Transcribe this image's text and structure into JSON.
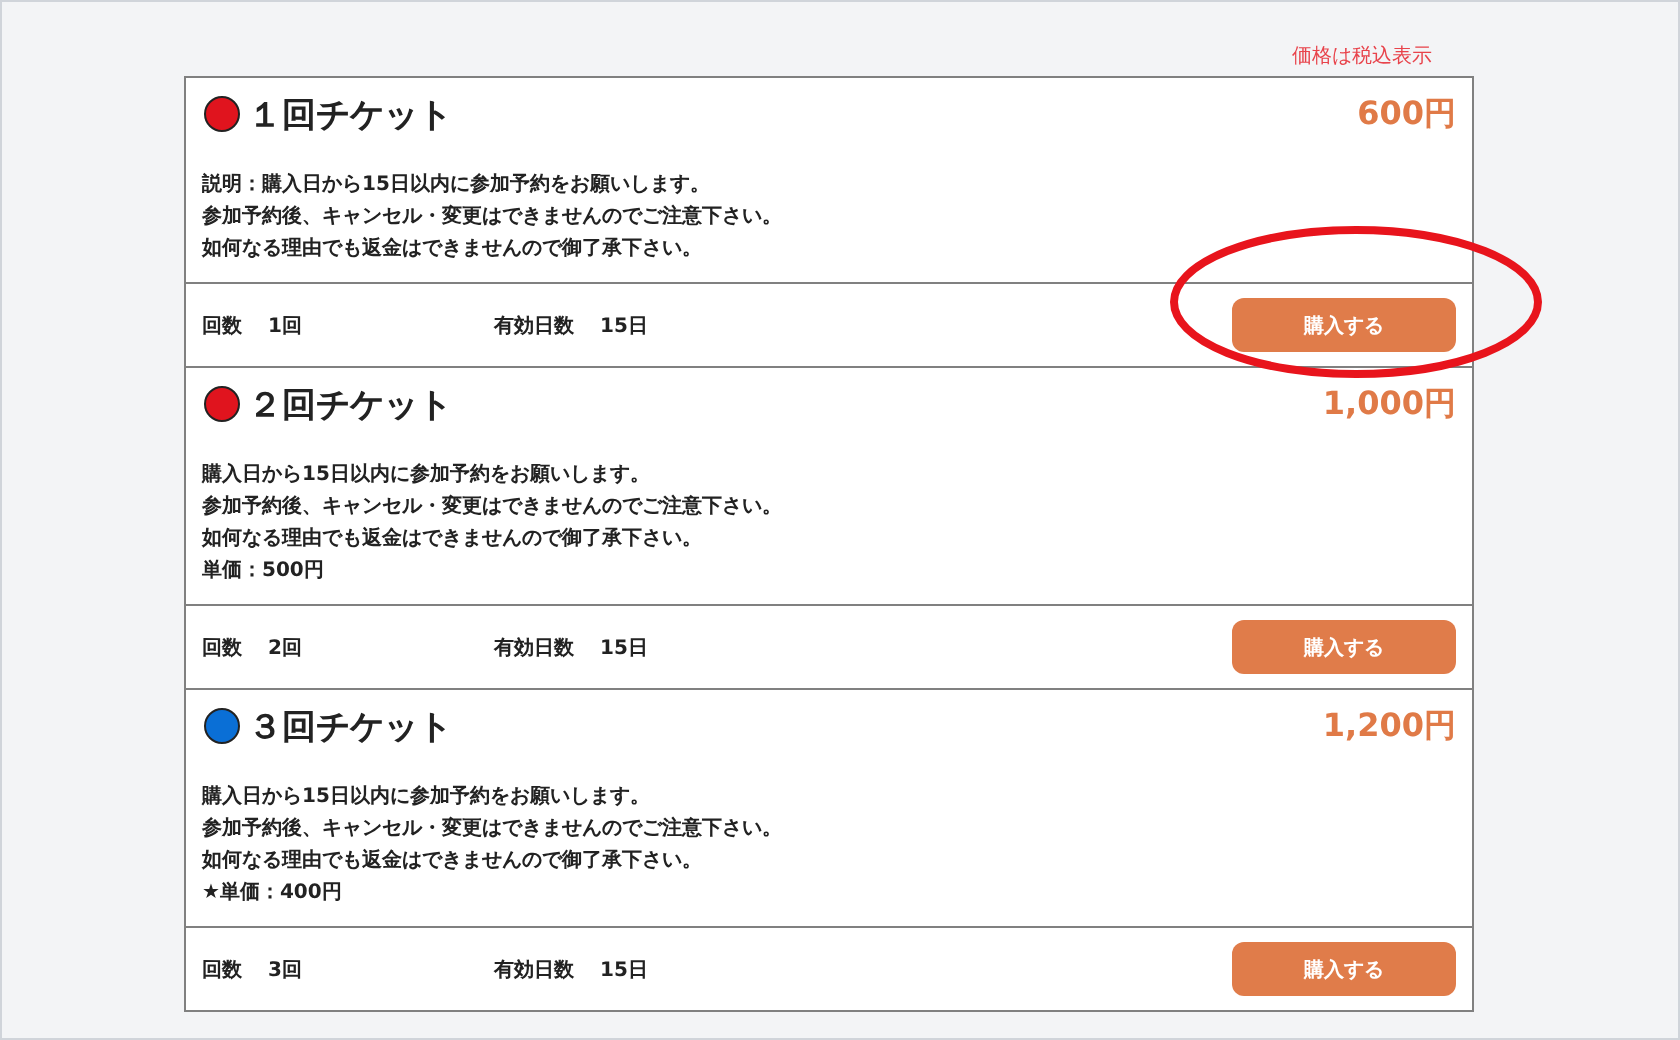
{
  "tax_note": "価格は税込表示",
  "tickets": [
    {
      "title": "１回チケット",
      "color": "#e0141e",
      "price": "600円",
      "description": [
        "説明：購入日から15日以内に参加予約をお願いします。",
        "参加予約後、キャンセル・変更はできませんのでご注意下さい。",
        "如何なる理由でも返金はできませんので御了承下さい。"
      ],
      "count_label": "回数",
      "count": "1回",
      "validity_label": "有効日数",
      "validity": "15日",
      "button": "購入する"
    },
    {
      "title": "２回チケット",
      "color": "#e0141e",
      "price": "1,000円",
      "description": [
        "購入日から15日以内に参加予約をお願いします。",
        "参加予約後、キャンセル・変更はできませんのでご注意下さい。",
        "如何なる理由でも返金はできませんので御了承下さい。",
        "単価：500円"
      ],
      "count_label": "回数",
      "count": "2回",
      "validity_label": "有効日数",
      "validity": "15日",
      "button": "購入する"
    },
    {
      "title": "３回チケット",
      "color": "#0a6fd6",
      "price": "1,200円",
      "description": [
        "購入日から15日以内に参加予約をお願いします。",
        "参加予約後、キャンセル・変更はできませんのでご注意下さい。",
        "如何なる理由でも返金はできませんので御了承下さい。",
        "★単価：400円"
      ],
      "count_label": "回数",
      "count": "3回",
      "validity_label": "有効日数",
      "validity": "15日",
      "button": "購入する"
    }
  ]
}
